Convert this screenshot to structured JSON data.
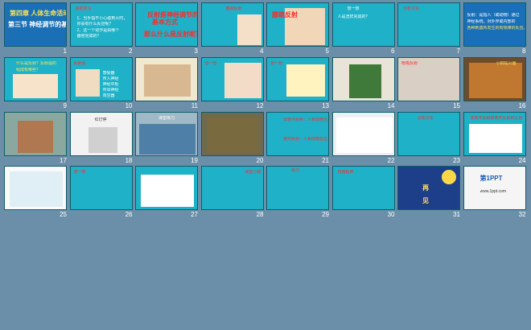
{
  "slides": [
    {
      "num": "1",
      "lines": [
        "第四章  人体生命活动的调节",
        "第三节 神经调节的基本方式"
      ]
    },
    {
      "num": "2",
      "lines": [
        "课前复习",
        "1、当手指不小心碰到火时，",
        "你会有什么反应呢？",
        "2、这一个动作是由哪个",
        "器官完成的？"
      ]
    },
    {
      "num": "3",
      "lines": [
        "反射是神经调节的",
        "基本方式",
        "那么什么是反射呢？"
      ]
    },
    {
      "num": "4",
      "lines": [
        "膝跳反射"
      ]
    },
    {
      "num": "5",
      "lines": [
        "膝跳反射"
      ]
    },
    {
      "num": "6",
      "lines": [
        "想一想",
        "人是怎样完成的？"
      ]
    },
    {
      "num": "7",
      "lines": [
        "分析讨论"
      ]
    },
    {
      "num": "8",
      "lines": [
        "反射：是指人（或动物）通过",
        "神经系统，对外界或内部的",
        "各种刺激所发生的有规律的反应。"
      ]
    },
    {
      "num": "9",
      "lines": [
        "什么是反射？反射弧的",
        "组成有哪些？"
      ]
    },
    {
      "num": "10",
      "lines": [
        "反射弧",
        "感受器",
        "传入神经",
        "神经中枢",
        "传出神经",
        "效应器"
      ]
    },
    {
      "num": "11",
      "lines": []
    },
    {
      "num": "12",
      "lines": [
        "想一想"
      ]
    },
    {
      "num": "13",
      "lines": [
        "想一想"
      ]
    },
    {
      "num": "14",
      "lines": []
    },
    {
      "num": "15",
      "lines": [
        "吮吸反射"
      ]
    },
    {
      "num": "16",
      "lines": [
        "小狗钻火圈"
      ]
    },
    {
      "num": "17",
      "lines": []
    },
    {
      "num": "18",
      "lines": [
        "红灯停"
      ]
    },
    {
      "num": "19",
      "lines": [
        "课堂练习"
      ]
    },
    {
      "num": "20",
      "lines": []
    },
    {
      "num": "21",
      "lines": [
        "非条件反射：人和动物生来就有的先天性反射。",
        "条件反射：人和动物在生活过程中逐渐形成的后天性反射。"
      ]
    },
    {
      "num": "22",
      "lines": []
    },
    {
      "num": "23",
      "lines": [
        "分析讨论"
      ]
    },
    {
      "num": "24",
      "lines": [
        "非条件反射和条件反射的区别"
      ]
    },
    {
      "num": "25",
      "lines": []
    },
    {
      "num": "26",
      "lines": [
        "想一想"
      ]
    },
    {
      "num": "27",
      "lines": []
    },
    {
      "num": "28",
      "lines": [
        "课堂小结"
      ]
    },
    {
      "num": "29",
      "lines": [
        "练习"
      ]
    },
    {
      "num": "30",
      "lines": [
        "拓展延伸"
      ]
    },
    {
      "num": "31",
      "lines": [
        "再",
        "见"
      ]
    },
    {
      "num": "32",
      "lines": [
        "第1PPT",
        "www.1ppt.com"
      ]
    }
  ],
  "colors": {
    "background": "#6b8fa8",
    "slide_bg": "#19b3c4",
    "number": "#ffffff"
  }
}
